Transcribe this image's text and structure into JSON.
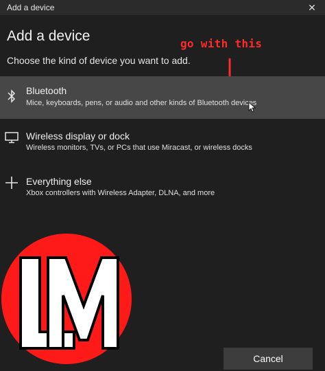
{
  "window": {
    "title": "Add a device",
    "close_glyph": "✕"
  },
  "heading": "Add a device",
  "subheading": "Choose the kind of device you want to add.",
  "annotation": {
    "text": "go with this",
    "color": "#ff2a2a"
  },
  "options": [
    {
      "icon": "bluetooth-icon",
      "title": "Bluetooth",
      "desc": "Mice, keyboards, pens, or audio and other kinds of Bluetooth devices",
      "selected": true
    },
    {
      "icon": "monitor-icon",
      "title": "Wireless display or dock",
      "desc": "Wireless monitors, TVs, or PCs that use Miracast, or wireless docks",
      "selected": false
    },
    {
      "icon": "plus-icon",
      "title": "Everything else",
      "desc": "Xbox controllers with Wireless Adapter, DLNA, and more",
      "selected": false
    }
  ],
  "logo": {
    "text": "LM",
    "color": "#ff1a1a"
  },
  "cancel_label": "Cancel"
}
